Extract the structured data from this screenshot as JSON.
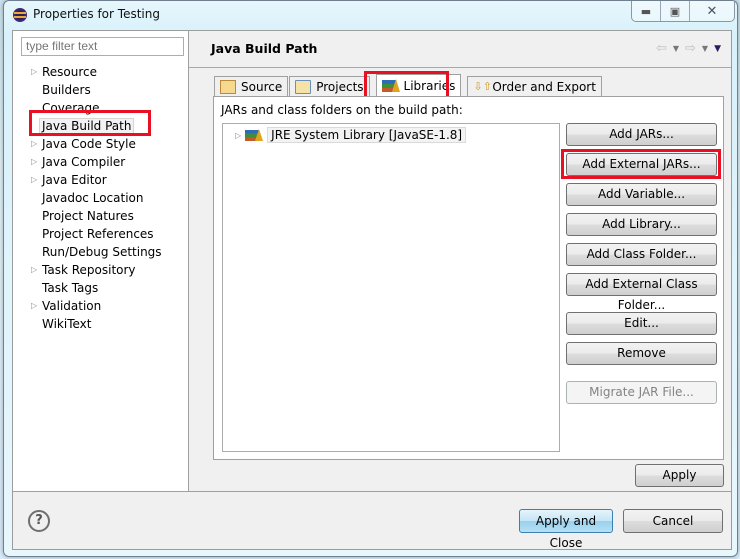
{
  "window": {
    "title": "Properties for Testing",
    "controls": {
      "minimize": "minimize-icon",
      "maximize": "maximize-icon",
      "close": "close-icon"
    }
  },
  "sidebar": {
    "filter_placeholder": "type filter text",
    "items": [
      {
        "label": "Resource",
        "expandable": true
      },
      {
        "label": "Builders",
        "expandable": false
      },
      {
        "label": "Coverage",
        "expandable": false
      },
      {
        "label": "Java Build Path",
        "expandable": false,
        "selected": true
      },
      {
        "label": "Java Code Style",
        "expandable": true
      },
      {
        "label": "Java Compiler",
        "expandable": true
      },
      {
        "label": "Java Editor",
        "expandable": true
      },
      {
        "label": "Javadoc Location",
        "expandable": false
      },
      {
        "label": "Project Natures",
        "expandable": false
      },
      {
        "label": "Project References",
        "expandable": false
      },
      {
        "label": "Run/Debug Settings",
        "expandable": false
      },
      {
        "label": "Task Repository",
        "expandable": true
      },
      {
        "label": "Task Tags",
        "expandable": false
      },
      {
        "label": "Validation",
        "expandable": true
      },
      {
        "label": "WikiText",
        "expandable": false
      }
    ]
  },
  "main": {
    "page_title": "Java Build Path",
    "tabs": [
      {
        "label": "Source",
        "icon": "source-folder-icon"
      },
      {
        "label": "Projects",
        "icon": "projects-folder-icon"
      },
      {
        "label": "Libraries",
        "icon": "library-icon",
        "active": true
      },
      {
        "label": "Order and Export",
        "icon": "order-export-icon"
      }
    ],
    "panel_label": "JARs and class folders on the build path:",
    "libraries": [
      {
        "label": "JRE System Library [JavaSE-1.8]",
        "icon": "library-icon"
      }
    ],
    "buttons": [
      {
        "label": "Add JARs...",
        "enabled": true
      },
      {
        "label": "Add External JARs...",
        "enabled": true,
        "highlighted": true
      },
      {
        "label": "Add Variable...",
        "enabled": true
      },
      {
        "label": "Add Library...",
        "enabled": true
      },
      {
        "label": "Add Class Folder...",
        "enabled": true
      },
      {
        "label": "Add External Class Folder...",
        "enabled": true
      },
      {
        "label": "Edit...",
        "enabled": true
      },
      {
        "label": "Remove",
        "enabled": true
      },
      {
        "label": "Migrate JAR File...",
        "enabled": false
      }
    ],
    "apply_label": "Apply"
  },
  "footer": {
    "help": "?",
    "apply_close_label": "Apply and Close",
    "cancel_label": "Cancel"
  },
  "annotation_color": "#e81123"
}
